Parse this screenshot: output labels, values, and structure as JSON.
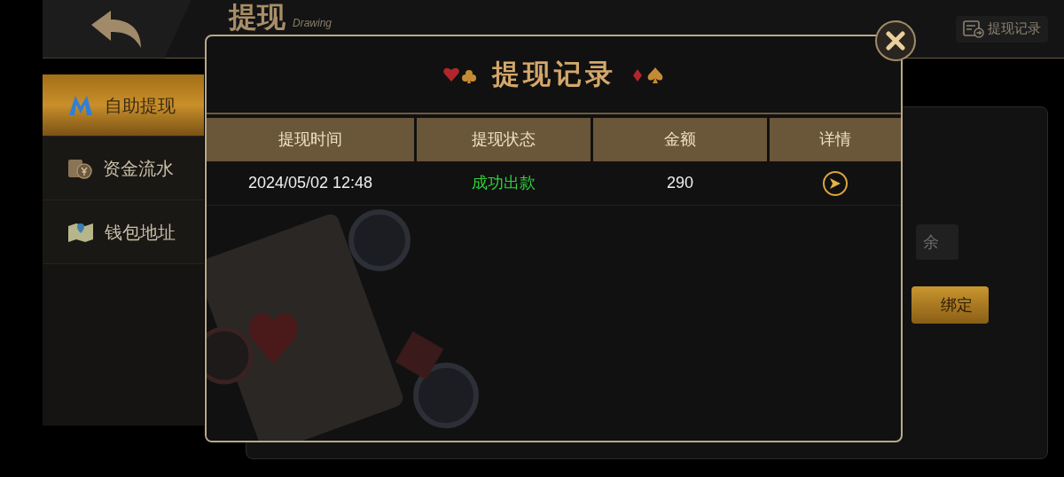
{
  "header": {
    "title": "提现",
    "subtitle": "Drawing",
    "records_button": "提现记录"
  },
  "sidebar": {
    "items": [
      {
        "label": "自助提现",
        "kind": "withdraw",
        "selected": true
      },
      {
        "label": "资金流水",
        "kind": "ledger",
        "selected": false
      },
      {
        "label": "钱包地址",
        "kind": "wallet",
        "selected": false
      }
    ]
  },
  "panel": {
    "button_1": "余",
    "button_2": "绑定"
  },
  "dialog": {
    "title": "提现记录",
    "table": {
      "columns": [
        "提现时间",
        "提现状态",
        "金额",
        "详情"
      ],
      "rows": [
        {
          "time": "2024/05/02 12:48",
          "status": "成功出款",
          "amount": "290"
        }
      ]
    }
  }
}
